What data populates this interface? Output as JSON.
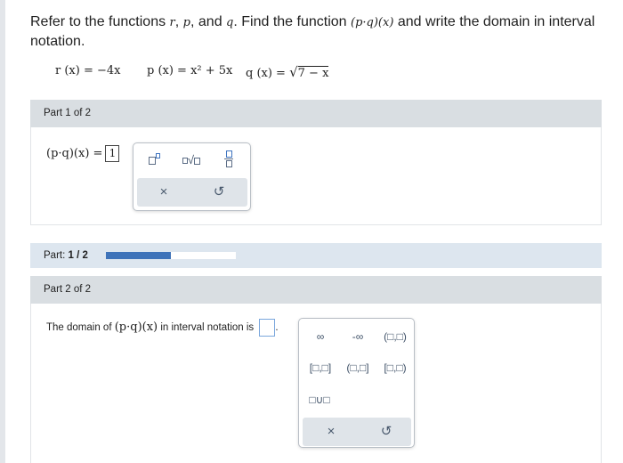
{
  "question": {
    "text_before": "Refer to the functions ",
    "var_r": "r",
    "var_p": "p",
    "var_q": "q",
    "text_middle": ". Find the function ",
    "composite": "(p·q)(x)",
    "text_after": " and write the domain in interval notation.",
    "comma": ",",
    "and": "and"
  },
  "functions": {
    "r": "r (x) = −4x",
    "p": "p (x) = x² + 5x",
    "q_left": "q (x) = ",
    "q_sqrt": "√",
    "q_radicand": "7 − x"
  },
  "part1": {
    "header": "Part 1 of 2",
    "expression": "(p·q)(x) =",
    "answer_value": "1",
    "palette": {
      "exponent_button": "□□",
      "nth_root_button": "□√□",
      "fraction_button": "□/□",
      "clear_symbol": "×",
      "undo_symbol": "↺"
    }
  },
  "progress": {
    "label_prefix": "Part:",
    "label_value": "1 / 2",
    "fraction": 0.5
  },
  "part2": {
    "header": "Part 2 of 2",
    "prompt_before": "The domain of",
    "expression": "(p·q)(x)",
    "prompt_after": "in interval notation is",
    "period": ".",
    "palette": {
      "infinity": "∞",
      "neg_infinity": "-∞",
      "open_open": "(□,□)",
      "closed_closed": "[□,□]",
      "open_closed": "(□,□]",
      "closed_open": "[□,□)",
      "union": "□∪□",
      "clear_symbol": "×",
      "undo_symbol": "↺"
    }
  },
  "colors": {
    "panel_header": "#d9dee2",
    "progress_fill": "#3e73b9",
    "progress_strip": "#dde6ef",
    "palette_footer": "#dfe4e9"
  }
}
